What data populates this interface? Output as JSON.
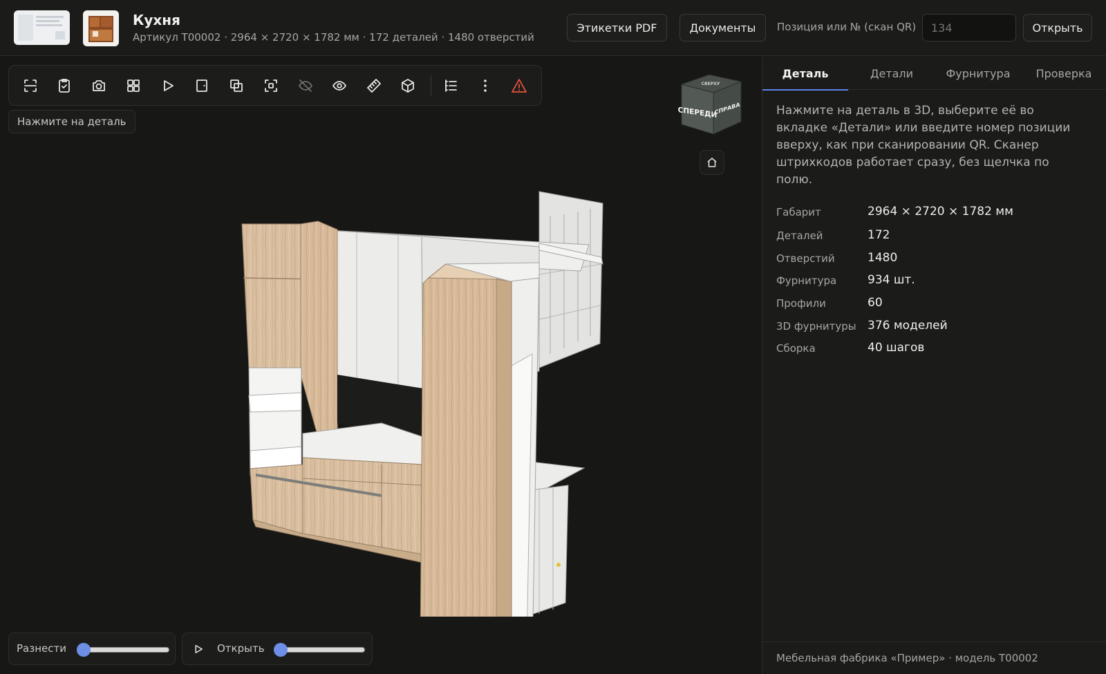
{
  "header": {
    "title": "Кухня",
    "subtitle": "Артикул T00002 · 2964 × 2720 × 1782 мм · 172 деталей · 1480 отверстий",
    "labels_pdf_button": "Этикетки PDF",
    "documents_button": "Документы",
    "position_label": "Позиция или № (скан QR)",
    "position_placeholder": "134",
    "open_button": "Открыть"
  },
  "viewport": {
    "hint": "Нажмите на деталь",
    "navcube": {
      "front": "СПЕРЕДИ",
      "right": "СПРАВА",
      "top": "СВЕРХУ"
    },
    "explode_label": "Разнести",
    "explode_value": 0,
    "open_label": "Открыть",
    "open_value": 0,
    "toolbar_icons": [
      "fit-icon",
      "checklist-icon",
      "camera-icon",
      "grid-icon",
      "play-icon",
      "panel-icon",
      "duplicate-icon",
      "focus-icon",
      "eye-off-icon",
      "eye-icon",
      "ruler-icon",
      "cube-icon",
      "list-icon",
      "more-icon",
      "warning-icon"
    ]
  },
  "panel": {
    "tabs": [
      {
        "label": "Деталь",
        "active": true
      },
      {
        "label": "Детали",
        "active": false
      },
      {
        "label": "Фурнитура",
        "active": false
      },
      {
        "label": "Проверка",
        "active": false
      }
    ],
    "description": "Нажмите на деталь в 3D, выберите её во вкладке «Детали» или введите номер позиции вверху, как при сканировании QR. Сканер штрихкодов работает сразу, без щелчка по полю.",
    "props": [
      {
        "label": "Габарит",
        "value": "2964 × 2720 × 1782 мм"
      },
      {
        "label": "Деталей",
        "value": "172"
      },
      {
        "label": "Отверстий",
        "value": "1480"
      },
      {
        "label": "Фурнитура",
        "value": "934 шт."
      },
      {
        "label": "Профили",
        "value": "60"
      },
      {
        "label": "3D фурнитуры",
        "value": "376 моделей"
      },
      {
        "label": "Сборка",
        "value": "40 шагов"
      }
    ],
    "footer": "Мебельная фабрика «Пример» · модель T00002"
  },
  "colors": {
    "accent": "#5b84e8",
    "warning": "#e5533d",
    "wood": "#d9bea0",
    "panel_white": "#ececec"
  }
}
